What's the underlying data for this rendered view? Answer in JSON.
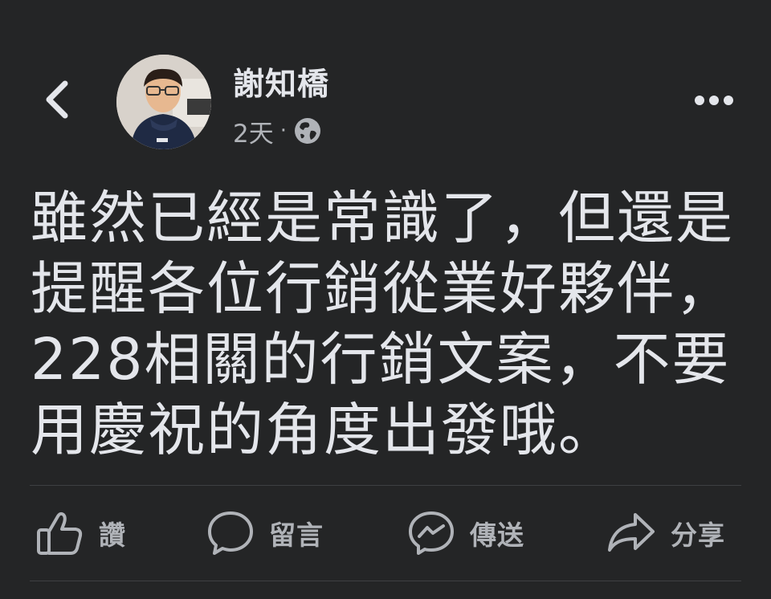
{
  "post": {
    "author": "謝知橋",
    "time": "2天",
    "separator": "·",
    "privacy_icon": "globe-icon",
    "text": "雖然已經是常識了，但還是\n提醒各位行銷從業好夥伴，\n228相關的行銷文案，不要\n用慶祝的角度出發哦。"
  },
  "header": {
    "back_icon": "chevron-left-icon",
    "more_icon": "more-horizontal-icon"
  },
  "actions": {
    "like_label": "讚",
    "comment_label": "留言",
    "send_label": "傳送",
    "share_label": "分享"
  },
  "colors": {
    "background": "#242526",
    "primary_text": "#e4e6eb",
    "secondary_text": "#b0b3b8",
    "divider": "#3e4042"
  }
}
